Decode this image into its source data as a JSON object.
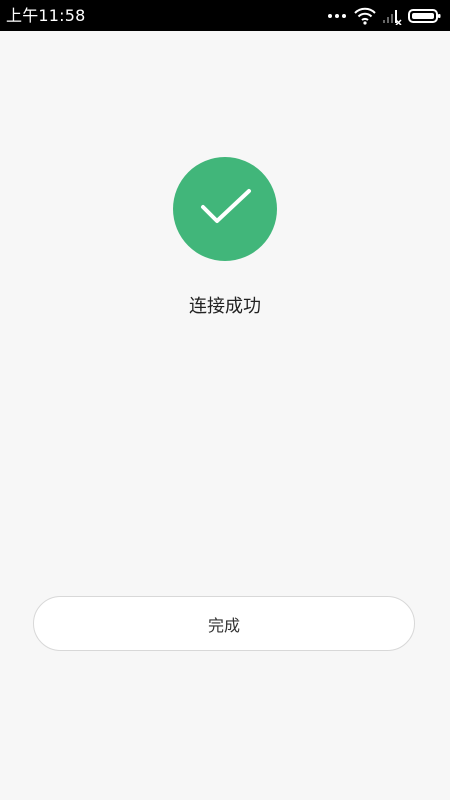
{
  "status_bar": {
    "time": "上午11:58",
    "icons": [
      "more-dots-icon",
      "wifi-icon",
      "signal-icon",
      "battery-icon"
    ]
  },
  "success": {
    "icon": "checkmark-icon",
    "circle_color": "#41b67a",
    "message": "连接成功"
  },
  "actions": {
    "done_label": "完成"
  }
}
